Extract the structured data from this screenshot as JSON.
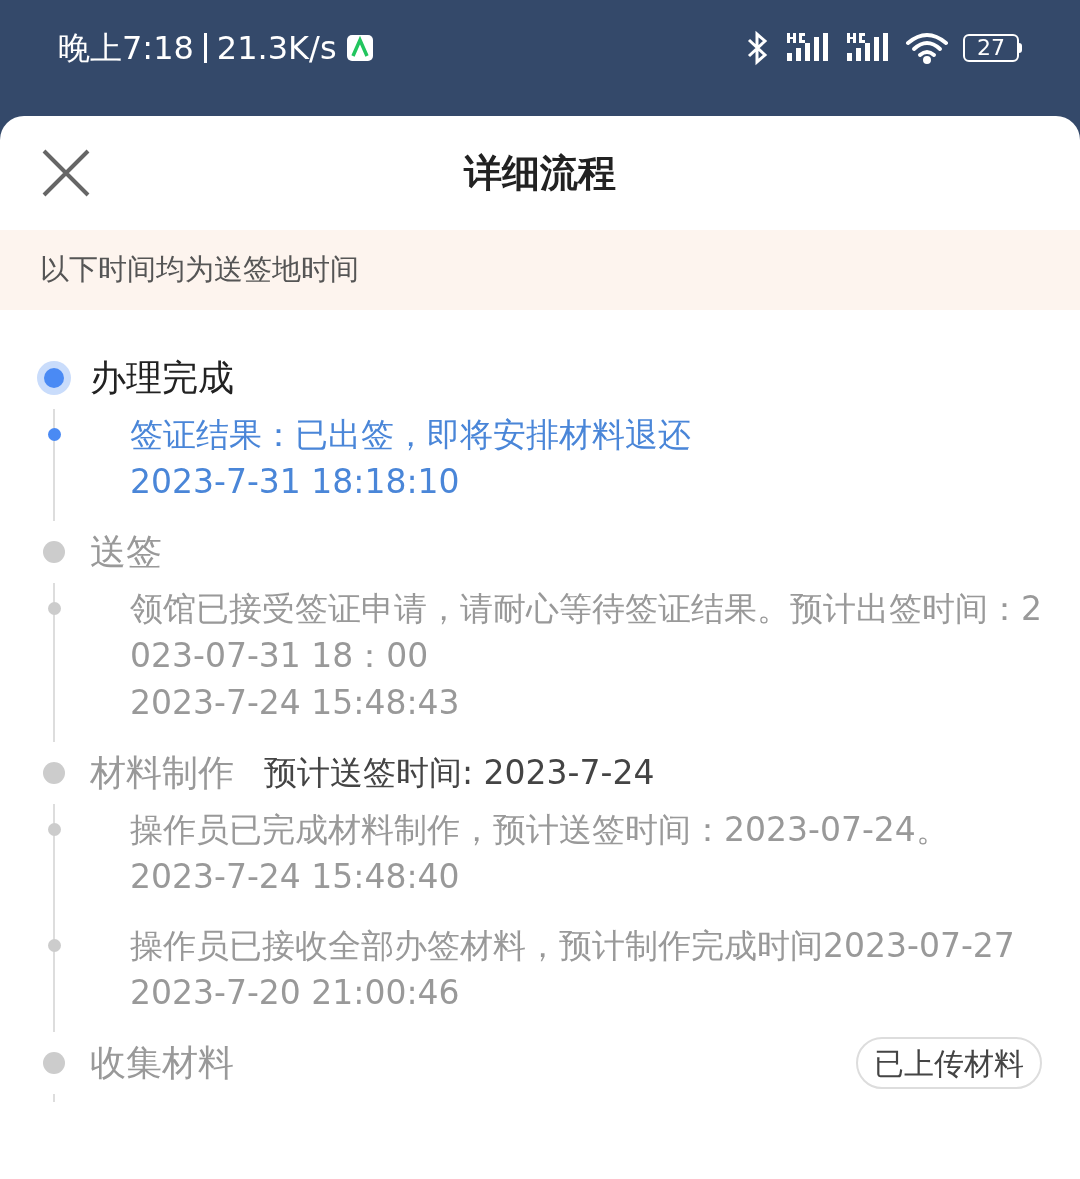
{
  "status_bar": {
    "time": "晚上7:18",
    "speed": "21.3K/s",
    "battery": "27"
  },
  "sheet": {
    "title": "详细流程"
  },
  "notice": "以下时间均为送签地时间",
  "stages": [
    {
      "title": "办理完成",
      "active": true,
      "events": [
        {
          "text": "签证结果：已出签，即将安排材料退还",
          "time": "2023-7-31 18:18:10"
        }
      ]
    },
    {
      "title": "送签",
      "active": false,
      "events": [
        {
          "text": "领馆已接受签证申请，请耐心等待签证结果。预计出签时间：2023-07-31 18：00",
          "time": "2023-7-24 15:48:43"
        }
      ]
    },
    {
      "title": "材料制作",
      "active": false,
      "note": "预计送签时间: 2023-7-24",
      "events": [
        {
          "text": "操作员已完成材料制作，预计送签时间：2023-07-24。",
          "time": "2023-7-24 15:48:40"
        },
        {
          "text": "操作员已接收全部办签材料，预计制作完成时间2023-07-27",
          "time": "2023-7-20 21:00:46"
        }
      ]
    },
    {
      "title": "收集材料",
      "active": false,
      "badge": "已上传材料"
    }
  ]
}
